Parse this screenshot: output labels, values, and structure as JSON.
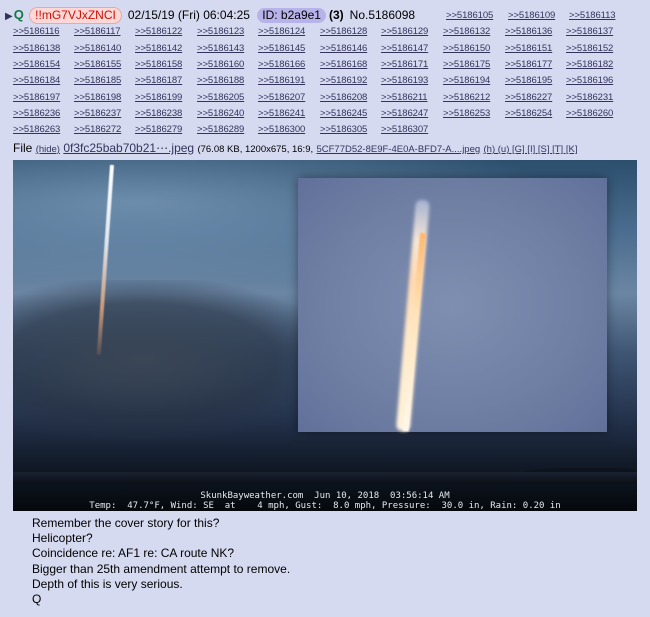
{
  "header": {
    "name": "Q",
    "tripcode": "!!mG7VJxZNCI",
    "datetime": "02/15/19 (Fri) 06:04:25",
    "id": "ID: b2a9e1",
    "count": "(3)",
    "post_number": "No.5186098"
  },
  "backlinks": [
    ">>5186105",
    ">>5186109",
    ">>5186113",
    ">>5186116",
    ">>5186117",
    ">>5186122",
    ">>5186123",
    ">>5186124",
    ">>5186128",
    ">>5186129",
    ">>5186132",
    ">>5186136",
    ">>5186137",
    ">>5186138",
    ">>5186140",
    ">>5186142",
    ">>5186143",
    ">>5186145",
    ">>5186146",
    ">>5186147",
    ">>5186150",
    ">>5186151",
    ">>5186152",
    ">>5186154",
    ">>5186155",
    ">>5186158",
    ">>5186160",
    ">>5186166",
    ">>5186168",
    ">>5186171",
    ">>5186175",
    ">>5186177",
    ">>5186182",
    ">>5186184",
    ">>5186185",
    ">>5186187",
    ">>5186188",
    ">>5186191",
    ">>5186192",
    ">>5186193",
    ">>5186194",
    ">>5186195",
    ">>5186196",
    ">>5186197",
    ">>5186198",
    ">>5186199",
    ">>5186205",
    ">>5186207",
    ">>5186208",
    ">>5186211",
    ">>5186212",
    ">>5186227",
    ">>5186231",
    ">>5186236",
    ">>5186237",
    ">>5186238",
    ">>5186240",
    ">>5186241",
    ">>5186245",
    ">>5186247",
    ">>5186253",
    ">>5186254",
    ">>5186260",
    ">>5186263",
    ">>5186272",
    ">>5186279",
    ">>5186289",
    ">>5186300",
    ">>5186305",
    ">>5186307"
  ],
  "file": {
    "label": "File",
    "hide": "(hide)",
    "filename": "0f3fc25bab70b21⋯.jpeg",
    "meta": "(76.08 KB, 1200x675, 16:9,",
    "original_name": "5CF77D52-8E9F-4E0A-BFD7-A....jpeg",
    "tools": "(h) (u) [G] [I] [S] [T] [K]"
  },
  "image_caption": {
    "line1": "SkunkBayweather.com  Jun 10, 2018  03:56:14 AM",
    "line2": "Temp:  47.7°F, Wind: SE  at    4 mph, Gust:  8.0 mph, Pressure:  30.0 in, Rain: 0.20 in"
  },
  "body_lines": [
    "Remember the cover story for this?",
    "Helicopter?",
    "Coincidence re: AF1 re: CA route NK?",
    "Bigger than 25th amendment attempt to remove.",
    "Depth of this is very serious.",
    "Q"
  ],
  "colors": {
    "background": "#d6daf0",
    "name": "#117743",
    "tripcode": "#cc1105",
    "link": "#34345c",
    "id_badge": "#b7b3ea"
  }
}
